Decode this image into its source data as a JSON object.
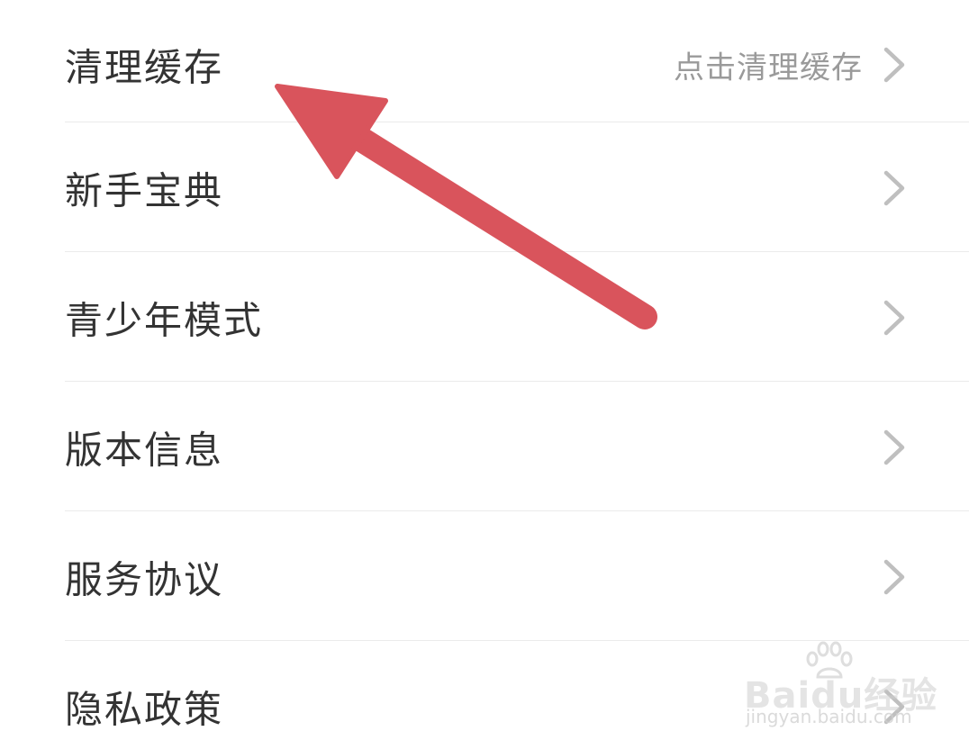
{
  "settings": {
    "items": [
      {
        "label": "清理缓存",
        "value": "点击清理缓存"
      },
      {
        "label": "新手宝典",
        "value": ""
      },
      {
        "label": "青少年模式",
        "value": ""
      },
      {
        "label": "版本信息",
        "value": ""
      },
      {
        "label": "服务协议",
        "value": ""
      },
      {
        "label": "隐私政策",
        "value": ""
      }
    ],
    "chevron_icon": "chevron-right-icon"
  },
  "annotation": {
    "arrow_color": "#d9545c"
  },
  "watermark": {
    "brand": "Baidu经验",
    "url": "jingyan.baidu.com"
  },
  "colors": {
    "label": "#333333",
    "value": "#9a9a9a",
    "chevron": "#bfbfbf",
    "divider": "#ebebeb",
    "background": "#ffffff"
  }
}
